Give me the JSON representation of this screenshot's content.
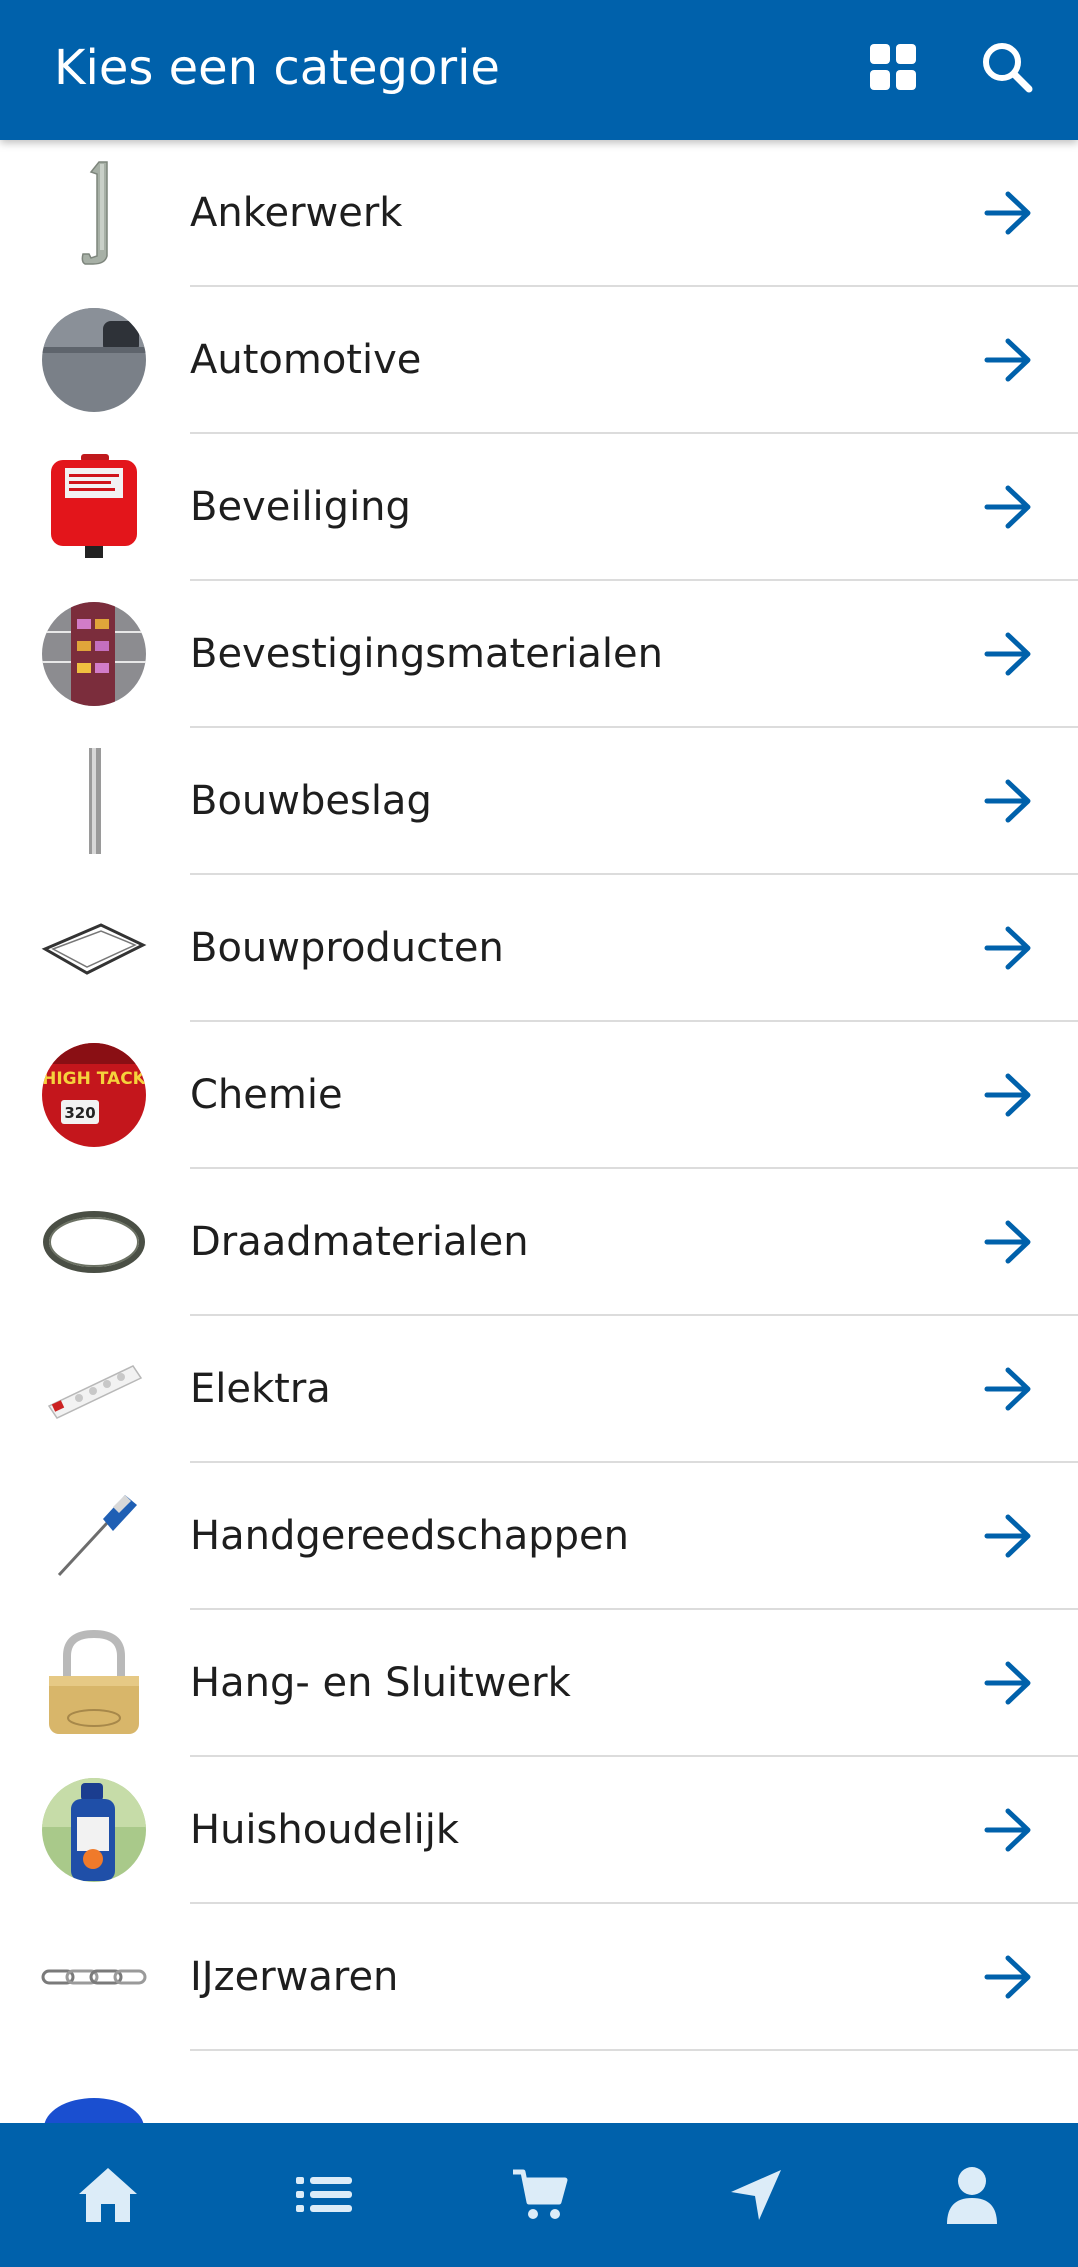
{
  "header": {
    "title": "Kies een categorie"
  },
  "categories": [
    {
      "label": "Ankerwerk",
      "icon": "anchor-bracket-icon"
    },
    {
      "label": "Automotive",
      "icon": "automotive-icon"
    },
    {
      "label": "Beveiliging",
      "icon": "fire-blanket-icon"
    },
    {
      "label": "Bevestigingsmaterialen",
      "icon": "fasteners-rack-icon"
    },
    {
      "label": "Bouwbeslag",
      "icon": "rod-icon"
    },
    {
      "label": "Bouwproducten",
      "icon": "frame-icon"
    },
    {
      "label": "Chemie",
      "icon": "high-tack-icon"
    },
    {
      "label": "Draadmaterialen",
      "icon": "wire-coil-icon"
    },
    {
      "label": "Elektra",
      "icon": "power-strip-icon"
    },
    {
      "label": "Handgereedschappen",
      "icon": "screwdriver-icon"
    },
    {
      "label": "Hang- en Sluitwerk",
      "icon": "padlock-icon"
    },
    {
      "label": "Huishoudelijk",
      "icon": "cleaner-bottle-icon"
    },
    {
      "label": "IJzerwaren",
      "icon": "chain-icon"
    }
  ],
  "thumb_texts": {
    "chemie_line1": "HIGH TACK",
    "chemie_line2": "320"
  },
  "colors": {
    "brand": "#0061ab",
    "accent": "#0061ab",
    "divider": "#dcdcdc"
  },
  "bottom_nav": [
    "home-icon",
    "list-icon",
    "cart-icon",
    "navigation-icon",
    "user-icon"
  ]
}
